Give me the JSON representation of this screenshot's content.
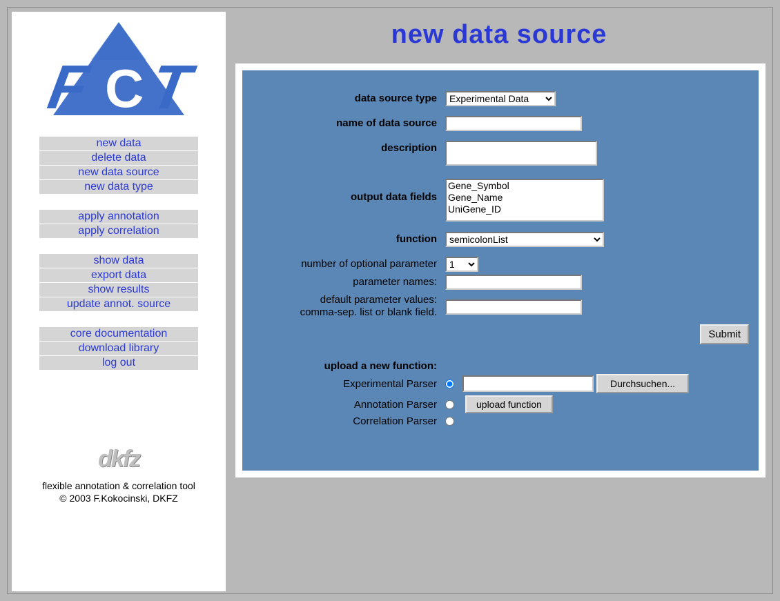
{
  "header": {
    "title": "new data source"
  },
  "sidebar": {
    "logo_text": "FCT",
    "groups": [
      [
        "new data",
        "delete data",
        "new data source",
        "new data type"
      ],
      [
        "apply annotation",
        "apply correlation"
      ],
      [
        "show data",
        "export data",
        "show results",
        "update annot. source"
      ],
      [
        "core documentation",
        "download library",
        "log out"
      ]
    ],
    "dkfz": "dkfz",
    "footer_line1": "flexible annotation & correlation tool",
    "footer_line2": "© 2003 F.Kokocinski, DKFZ"
  },
  "form": {
    "labels": {
      "data_source_type": "data source type",
      "name": "name of data source",
      "description": "description",
      "output_fields": "output data fields",
      "function": "function",
      "num_params": "number of optional parameter",
      "param_names": "parameter names:",
      "default_values_l1": "default parameter values:",
      "default_values_l2": "comma-sep. list or blank field."
    },
    "data_source_type_selected": "Experimental Data",
    "data_source_type_options": [
      "Experimental Data"
    ],
    "name_value": "",
    "description_value": "",
    "output_fields_options": [
      "Gene_Symbol",
      "Gene_Name",
      "UniGene_ID"
    ],
    "function_selected": "semicolonList",
    "function_options": [
      "semicolonList"
    ],
    "num_params_selected": "1",
    "num_params_options": [
      "1"
    ],
    "param_names_value": "",
    "default_values_value": "",
    "submit_label": "Submit"
  },
  "upload": {
    "heading": "upload a new function:",
    "parsers": [
      "Experimental Parser",
      "Annotation Parser",
      "Correlation Parser"
    ],
    "browse_label": "Durchsuchen...",
    "upload_label": "upload function"
  }
}
